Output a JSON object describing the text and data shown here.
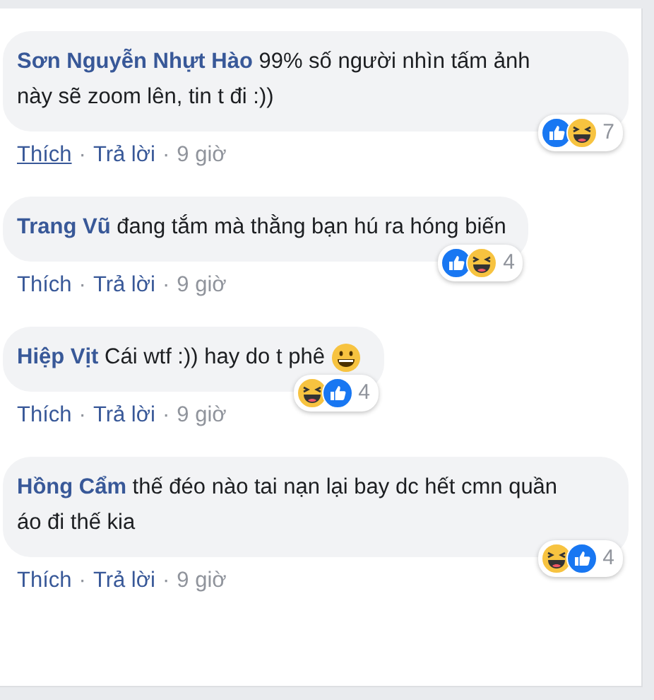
{
  "comments": [
    {
      "author": "Sơn Nguyễn Nhựt Hào",
      "text": "99% số người nhìn tấm ảnh này sẽ zoom lên, tin t đi :))",
      "reactions": [
        {
          "kind": "like"
        },
        {
          "kind": "haha"
        }
      ],
      "reaction_count": "7",
      "actions": [
        {
          "label": "Thích",
          "hovered": true
        },
        {
          "label": "Trả lời",
          "hovered": false
        }
      ],
      "separator": "·",
      "time": "9 giờ"
    },
    {
      "author": "Trang Vũ",
      "text": "đang tắm mà thằng bạn hú ra hóng biến",
      "reactions": [
        {
          "kind": "like"
        },
        {
          "kind": "haha"
        }
      ],
      "reaction_count": "4",
      "actions": [
        {
          "label": "Thích",
          "hovered": false
        },
        {
          "label": "Trả lời",
          "hovered": false
        }
      ],
      "separator": "·",
      "time": "9 giờ"
    },
    {
      "author": "Hiệp Vịt",
      "text": "Cái wtf :)) hay do t phê",
      "emoji": {
        "kind": "grin"
      },
      "reactions": [
        {
          "kind": "haha"
        },
        {
          "kind": "like"
        }
      ],
      "reaction_count": "4",
      "actions": [
        {
          "label": "Thích",
          "hovered": false
        },
        {
          "label": "Trả lời",
          "hovered": false
        }
      ],
      "separator": "·",
      "time": "9 giờ"
    },
    {
      "author": "Hồng Cẩm",
      "text": "thế đéo nào tai nạn lại bay dc hết cmn quần áo đi thế kia",
      "reactions": [
        {
          "kind": "haha"
        },
        {
          "kind": "like"
        }
      ],
      "reaction_count": "4",
      "actions": [
        {
          "label": "Thích",
          "hovered": false
        },
        {
          "label": "Trả lời",
          "hovered": false
        }
      ],
      "separator": "·",
      "time": "9 giờ"
    }
  ]
}
